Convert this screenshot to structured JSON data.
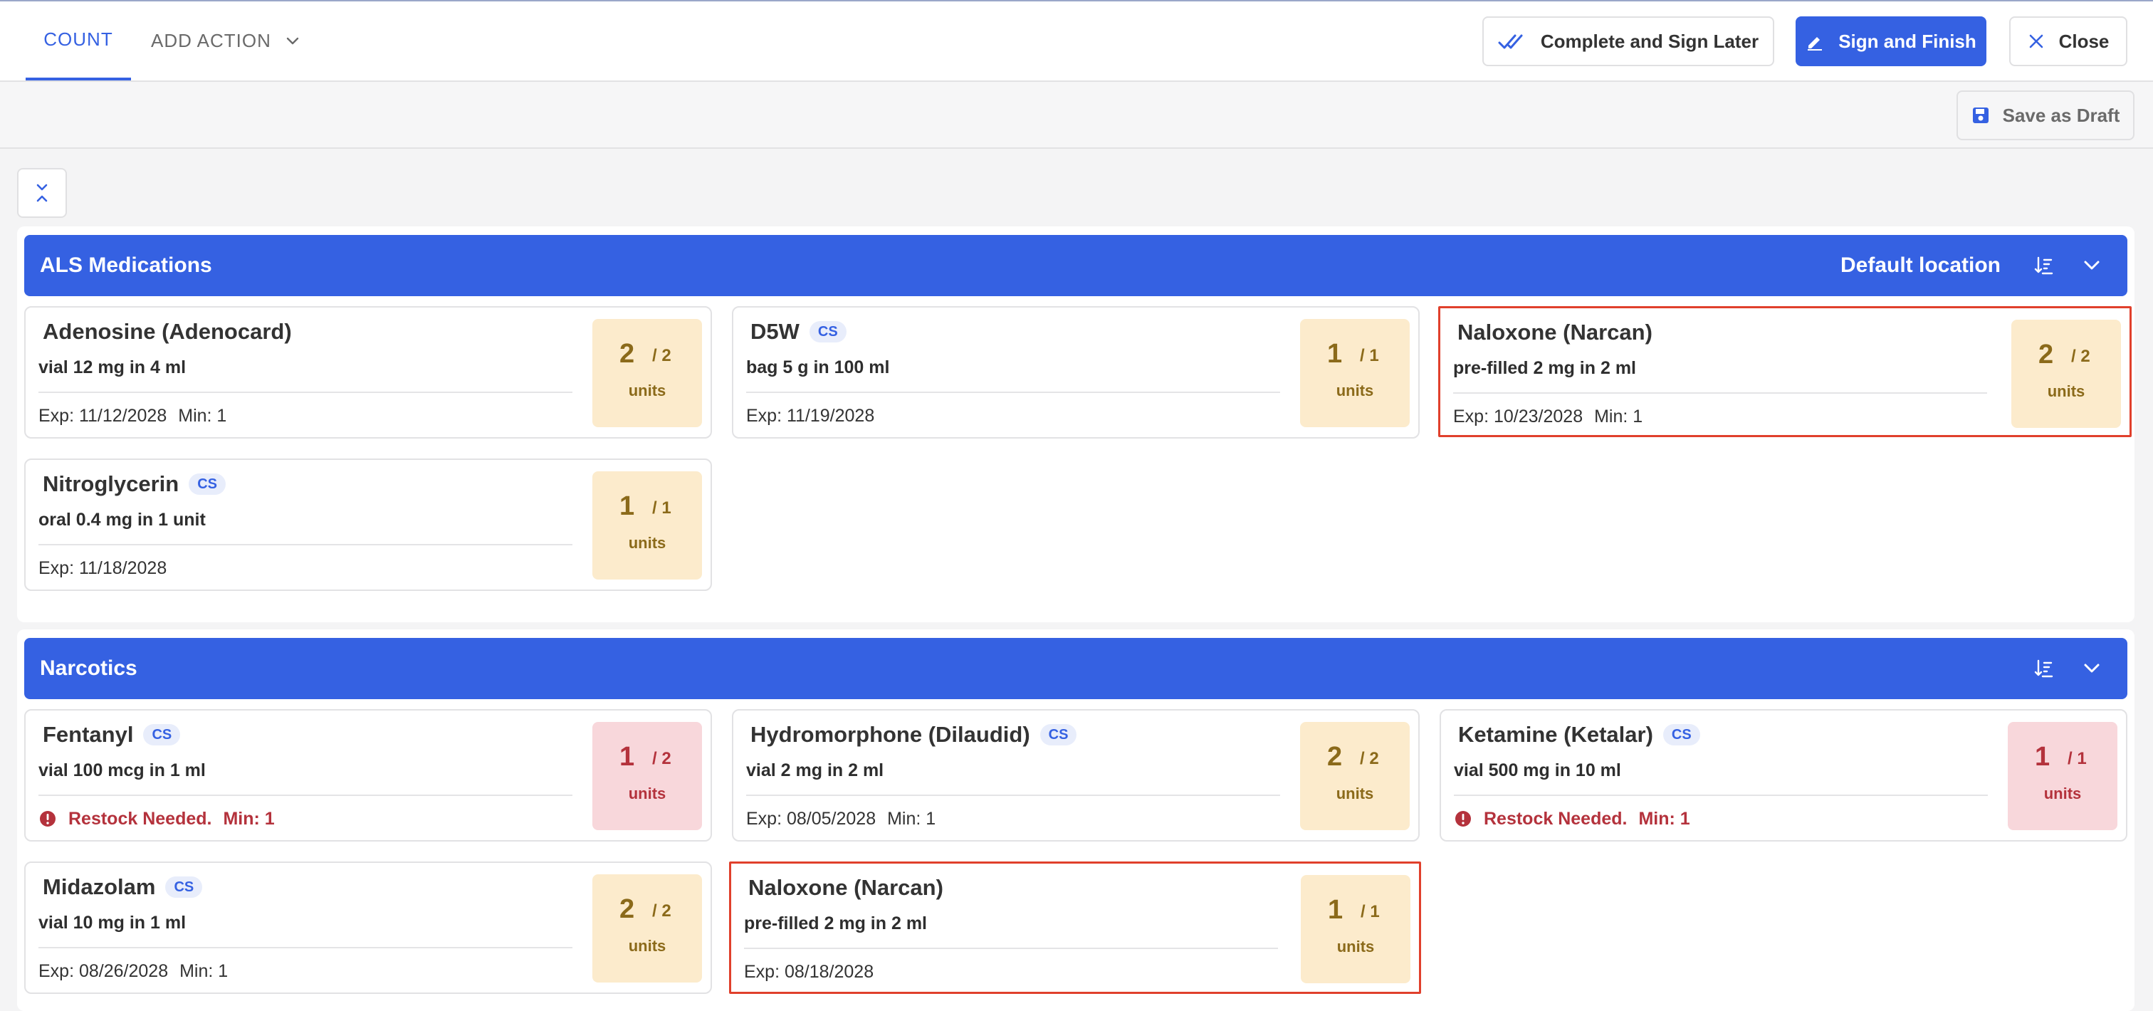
{
  "tabs": {
    "count": "COUNT",
    "add_action": "ADD ACTION"
  },
  "actions": {
    "complete_later": "Complete and Sign Later",
    "sign_finish": "Sign and Finish",
    "close": "Close",
    "save_draft": "Save as Draft"
  },
  "colors": {
    "primary": "#3561e2",
    "highlight_border": "#e0402c",
    "qty_ok_bg": "#fcebcc",
    "qty_low_bg": "#f8d7db",
    "restock_text": "#b4323c"
  },
  "sections": [
    {
      "title": "ALS Medications",
      "location": "Default location",
      "items": [
        {
          "name": "Adenosine (Adenocard)",
          "cs": "",
          "desc": "vial 12 mg in 4 ml",
          "exp": "Exp: 11/12/2028",
          "min": "Min: 1",
          "restock": "",
          "qty": "2",
          "total": "/ 2",
          "unit": "units",
          "status": "ok",
          "highlighted": false
        },
        {
          "name": "D5W",
          "cs": "CS",
          "desc": "bag 5 g in 100 ml",
          "exp": "Exp: 11/19/2028",
          "min": "",
          "restock": "",
          "qty": "1",
          "total": "/ 1",
          "unit": "units",
          "status": "ok",
          "highlighted": false
        },
        {
          "name": "Naloxone (Narcan)",
          "cs": "",
          "desc": "pre-filled 2 mg in 2 ml",
          "exp": "Exp: 10/23/2028",
          "min": "Min: 1",
          "restock": "",
          "qty": "2",
          "total": "/ 2",
          "unit": "units",
          "status": "ok",
          "highlighted": true
        },
        {
          "name": "Nitroglycerin",
          "cs": "CS",
          "desc": "oral 0.4 mg in 1 unit",
          "exp": "Exp: 11/18/2028",
          "min": "",
          "restock": "",
          "qty": "1",
          "total": "/ 1",
          "unit": "units",
          "status": "ok",
          "highlighted": false
        }
      ]
    },
    {
      "title": "Narcotics",
      "location": "",
      "items": [
        {
          "name": "Fentanyl",
          "cs": "CS",
          "desc": "vial 100 mcg in 1 ml",
          "exp": "",
          "min": "Min: 1",
          "restock": "Restock Needed.",
          "qty": "1",
          "total": "/ 2",
          "unit": "units",
          "status": "low",
          "highlighted": false
        },
        {
          "name": "Hydromorphone (Dilaudid)",
          "cs": "CS",
          "desc": "vial 2 mg in 2 ml",
          "exp": "Exp: 08/05/2028",
          "min": "Min: 1",
          "restock": "",
          "qty": "2",
          "total": "/ 2",
          "unit": "units",
          "status": "ok",
          "highlighted": false
        },
        {
          "name": "Ketamine (Ketalar)",
          "cs": "CS",
          "desc": "vial 500 mg in 10 ml",
          "exp": "",
          "min": "Min: 1",
          "restock": "Restock Needed.",
          "qty": "1",
          "total": "/ 1",
          "unit": "units",
          "status": "low",
          "highlighted": false
        },
        {
          "name": "Midazolam",
          "cs": "CS",
          "desc": "vial 10 mg in 1 ml",
          "exp": "Exp: 08/26/2028",
          "min": "Min: 1",
          "restock": "",
          "qty": "2",
          "total": "/ 2",
          "unit": "units",
          "status": "ok",
          "highlighted": false
        },
        {
          "name": "Naloxone (Narcan)",
          "cs": "",
          "desc": "pre-filled 2 mg in 2 ml",
          "exp": "Exp: 08/18/2028",
          "min": "",
          "restock": "",
          "qty": "1",
          "total": "/ 1",
          "unit": "units",
          "status": "ok",
          "highlighted": true
        }
      ]
    }
  ]
}
